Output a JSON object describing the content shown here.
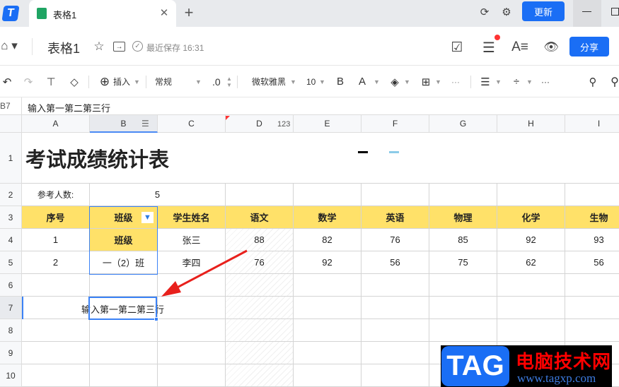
{
  "tabs": {
    "active": "表格1",
    "new_tab": "+"
  },
  "window": {
    "update_label": "更新"
  },
  "header": {
    "title": "表格1",
    "save_status": "最近保存 16:31",
    "share_label": "分享"
  },
  "toolbar": {
    "insert": "插入",
    "format": "常规",
    "decimal": ".0",
    "font": "微软雅黑",
    "font_size": "10",
    "bold": "B",
    "font_color": "A",
    "more": "···",
    "font_color_hex": "#000000",
    "fill_color_hex": "#8ccbe8"
  },
  "formula": {
    "cell_ref": "B7",
    "value": "输入第一第二第三行"
  },
  "columns": [
    "A",
    "B",
    "C",
    "D",
    "E",
    "F",
    "G",
    "H",
    "I"
  ],
  "col_d_badge": "123",
  "rows": [
    "1",
    "2",
    "3",
    "4",
    "5",
    "6",
    "7",
    "8",
    "9",
    "10"
  ],
  "sheet": {
    "title": "考试成绩统计表",
    "count_label": "参考人数:",
    "count_value": "5",
    "headers": [
      "序号",
      "班级",
      "学生姓名",
      "语文",
      "数学",
      "英语",
      "物理",
      "化学",
      "生物"
    ],
    "data": [
      [
        "1",
        "班级",
        "张三",
        "88",
        "82",
        "76",
        "85",
        "92",
        "93"
      ],
      [
        "2",
        "一（2）班",
        "李四",
        "76",
        "92",
        "56",
        "75",
        "62",
        "56"
      ]
    ],
    "row7_text": "输入第一第二第三行"
  },
  "watermark": {
    "logo": "TAG",
    "name": "电脑技术网",
    "url": "www.tagxp.com"
  },
  "colors": {
    "accent": "#1a6ef5",
    "header_fill": "#ffe169",
    "arrow": "#e8201c"
  }
}
